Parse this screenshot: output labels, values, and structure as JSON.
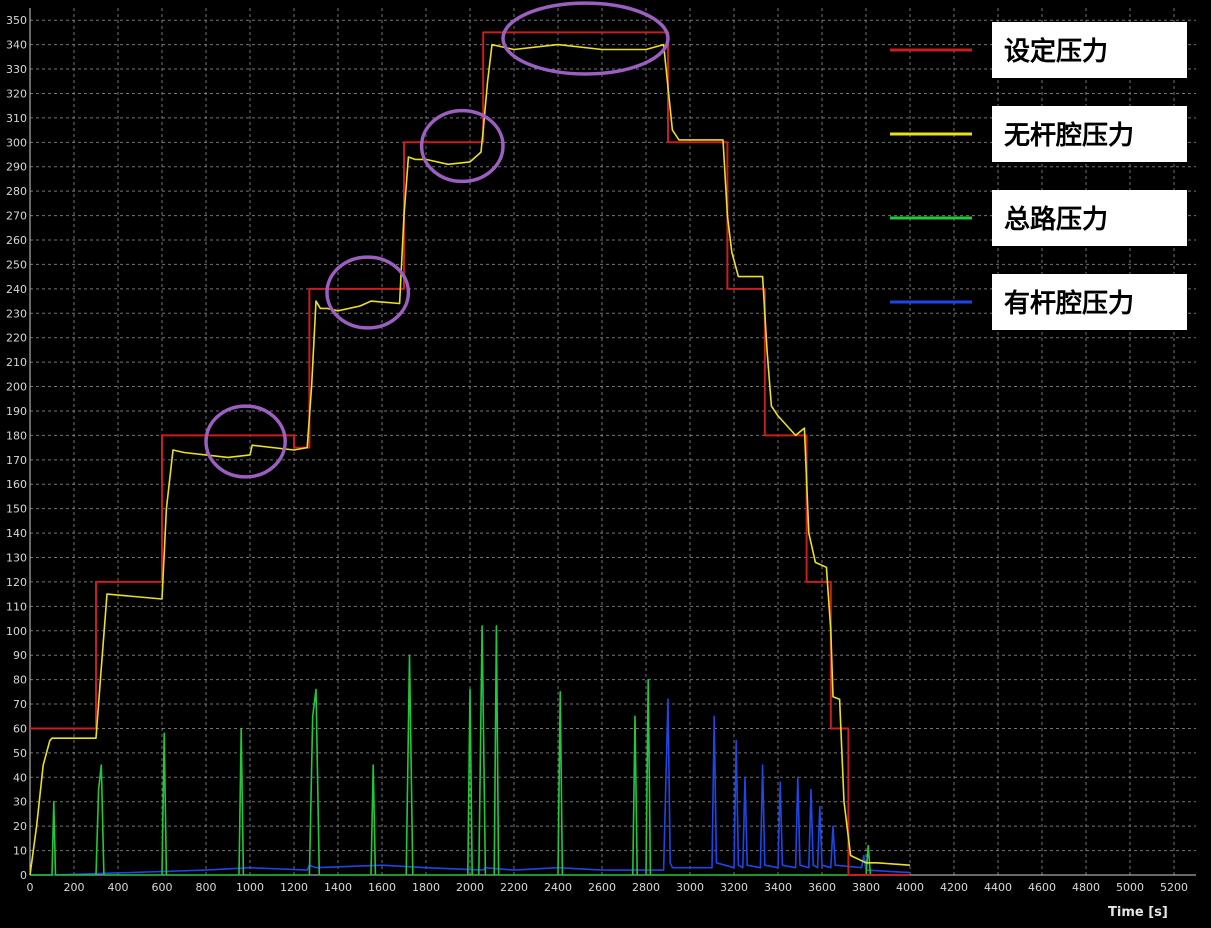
{
  "chart_data": {
    "type": "line",
    "xlabel": "Time [s]",
    "ylabel": "",
    "xlim": [
      0,
      5300
    ],
    "ylim": [
      0,
      355
    ],
    "x_ticks": [
      0,
      200,
      400,
      600,
      800,
      1000,
      1200,
      1400,
      1600,
      1800,
      2000,
      2200,
      2400,
      2600,
      2800,
      3000,
      3200,
      3400,
      3600,
      3800,
      4000,
      4200,
      4400,
      4600,
      4800,
      5000,
      5200
    ],
    "y_ticks": [
      0,
      10,
      20,
      30,
      40,
      50,
      60,
      70,
      80,
      90,
      100,
      110,
      120,
      130,
      140,
      150,
      160,
      170,
      180,
      190,
      200,
      210,
      220,
      230,
      240,
      250,
      260,
      270,
      280,
      290,
      300,
      310,
      320,
      330,
      340,
      350
    ],
    "grid": true,
    "legend_position": "top-right",
    "series": [
      {
        "name": "设定压力",
        "color": "#c81e1e",
        "x": [
          0,
          300,
          300,
          600,
          600,
          1200,
          1200,
          1270,
          1270,
          1700,
          1700,
          2060,
          2060,
          2900,
          2900,
          3170,
          3170,
          3340,
          3340,
          3530,
          3530,
          3640,
          3640,
          3720,
          3720,
          3800,
          3800,
          4000
        ],
        "y": [
          60,
          60,
          120,
          120,
          180,
          180,
          175,
          175,
          240,
          240,
          300,
          300,
          345,
          345,
          300,
          300,
          240,
          240,
          180,
          180,
          120,
          120,
          60,
          60,
          0,
          0,
          0,
          0
        ]
      },
      {
        "name": "无杆腔压力",
        "color": "#e8e020",
        "x": [
          0,
          30,
          60,
          90,
          100,
          300,
          320,
          350,
          600,
          620,
          650,
          700,
          900,
          1000,
          1010,
          1200,
          1260,
          1280,
          1300,
          1320,
          1350,
          1400,
          1500,
          1550,
          1680,
          1700,
          1720,
          1750,
          1800,
          1900,
          2000,
          2050,
          2060,
          2080,
          2100,
          2200,
          2400,
          2600,
          2800,
          2880,
          2920,
          2950,
          3150,
          3170,
          3190,
          3220,
          3330,
          3350,
          3370,
          3400,
          3480,
          3520,
          3540,
          3570,
          3620,
          3640,
          3650,
          3680,
          3700,
          3730,
          3800,
          3850,
          4000
        ],
        "y": [
          0,
          20,
          45,
          55,
          56,
          56,
          80,
          115,
          113,
          150,
          174,
          173,
          171,
          172,
          176,
          174,
          175,
          200,
          235,
          232,
          232,
          231,
          233,
          235,
          234,
          270,
          294,
          293,
          293,
          291,
          292,
          296,
          305,
          325,
          340,
          338,
          340,
          338,
          338,
          340,
          305,
          301,
          301,
          270,
          255,
          245,
          245,
          215,
          192,
          188,
          180,
          183,
          140,
          128,
          126,
          100,
          73,
          72,
          30,
          8,
          5,
          5,
          4
        ]
      },
      {
        "name": "总路压力",
        "color": "#22c83a",
        "x": [
          0,
          100,
          108,
          116,
          300,
          312,
          324,
          336,
          600,
          610,
          620,
          950,
          960,
          970,
          1270,
          1285,
          1300,
          1315,
          1550,
          1560,
          1570,
          1710,
          1725,
          1740,
          1990,
          2000,
          2010,
          2040,
          2055,
          2070,
          2110,
          2120,
          2130,
          2400,
          2410,
          2420,
          2740,
          2750,
          2760,
          2800,
          2810,
          2820,
          3000,
          3400,
          3700,
          3800,
          3810,
          3820,
          4000
        ],
        "y": [
          0,
          0,
          30,
          0,
          0,
          35,
          45,
          0,
          0,
          58,
          0,
          0,
          60,
          0,
          0,
          65,
          76,
          0,
          0,
          45,
          0,
          0,
          90,
          0,
          0,
          76,
          0,
          0,
          102,
          0,
          0,
          102,
          0,
          0,
          75,
          0,
          0,
          65,
          0,
          0,
          80,
          0,
          0,
          0,
          0,
          0,
          12,
          0,
          0
        ]
      },
      {
        "name": "有杆腔压力",
        "color": "#1e46e6",
        "x": [
          0,
          100,
          800,
          1000,
          1260,
          1270,
          1300,
          1600,
          1800,
          2060,
          2070,
          2200,
          2400,
          2600,
          2880,
          2900,
          2910,
          2920,
          2930,
          3100,
          3110,
          3120,
          3200,
          3210,
          3220,
          3240,
          3250,
          3260,
          3320,
          3330,
          3340,
          3400,
          3410,
          3420,
          3480,
          3490,
          3500,
          3540,
          3550,
          3560,
          3580,
          3590,
          3600,
          3640,
          3650,
          3660,
          3780,
          3790,
          3800,
          4000
        ],
        "y": [
          0,
          0,
          2,
          3,
          2,
          4,
          3,
          4,
          3,
          2,
          3,
          2,
          3,
          2,
          2,
          72,
          5,
          3,
          3,
          3,
          65,
          5,
          3,
          55,
          4,
          3,
          40,
          4,
          3,
          45,
          4,
          3,
          38,
          4,
          3,
          40,
          4,
          3,
          35,
          4,
          3,
          28,
          4,
          3,
          20,
          4,
          3,
          8,
          2,
          1
        ]
      }
    ],
    "annotations": [
      {
        "shape": "ellipse",
        "color": "#9b5fc0",
        "x_range": [
          800,
          1160
        ],
        "y_range": [
          163,
          192
        ]
      },
      {
        "shape": "ellipse",
        "color": "#9b5fc0",
        "x_range": [
          1350,
          1720
        ],
        "y_range": [
          224,
          253
        ]
      },
      {
        "shape": "ellipse",
        "color": "#9b5fc0",
        "x_range": [
          1780,
          2150
        ],
        "y_range": [
          284,
          313
        ]
      },
      {
        "shape": "ellipse",
        "color": "#9b5fc0",
        "x_range": [
          2150,
          2900
        ],
        "y_range": [
          328,
          357
        ]
      }
    ]
  }
}
